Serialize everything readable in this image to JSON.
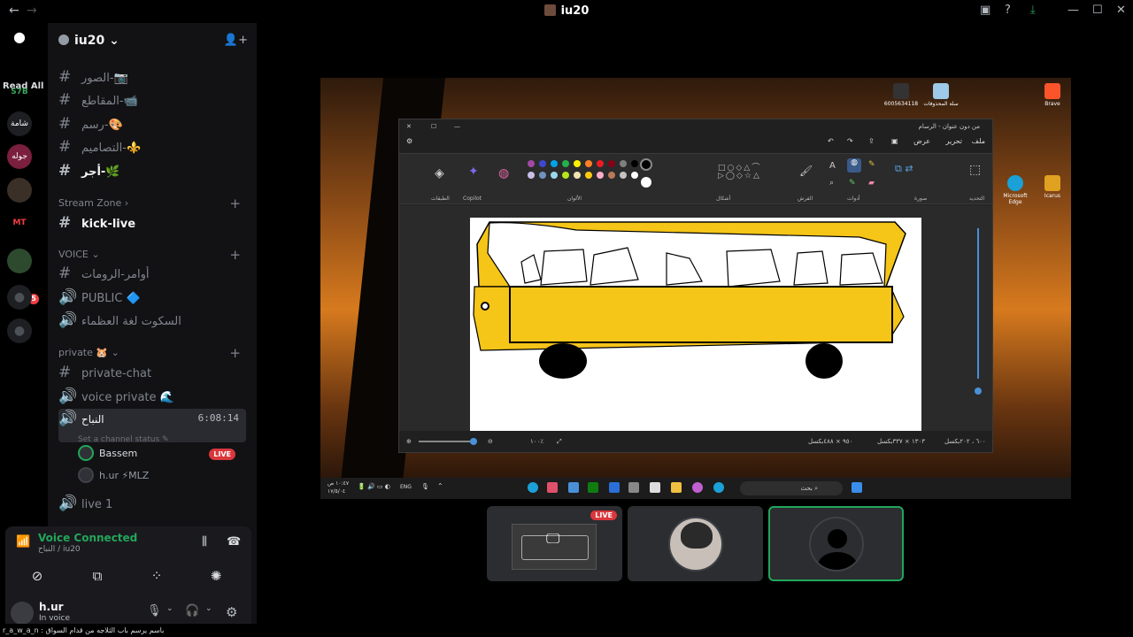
{
  "window": {
    "title": "iu20",
    "back": "←",
    "forward": "→"
  },
  "servers": {
    "read_all": "Read All",
    "s1": "S7B",
    "s2": "شامة",
    "s3": "جوله",
    "s4": "MT",
    "badge": "5"
  },
  "guild": {
    "name": "iu20"
  },
  "channels": {
    "c1": "الصور-📷",
    "c2": "المقاطع-📹",
    "c3": "رسم-🎨",
    "c4": "التصاميم-⚜️",
    "c5": "أجر-🌿",
    "cat_stream": "Stream Zone",
    "c6": "kick-live",
    "cat_voice": "VOICE",
    "c7": "أوامر-الرومات",
    "c8": "PUBLIC 🔷",
    "c9": "السكوت لغة العظماء",
    "cat_private": "private 🐹",
    "c10": "private-chat",
    "c11": "voice private 🌊",
    "c12": "النباح",
    "timer": "6:08:14",
    "status": "Set a channel status ✎",
    "user1": "Bassem",
    "user1_live": "LIVE",
    "user2": "h.ur ⚡MLZ",
    "c13": "live 1"
  },
  "voice_panel": {
    "connected": "Voice Connected",
    "location": "النباح / iu20",
    "user": "h.ur",
    "user_status": "In voice"
  },
  "ticker": "r_a_w_a_n : باسم يرسم باب الثلاجه من قدام السواق",
  "stream": {
    "paint_title": "من دون عنوان - الرسام",
    "menu_file": "ملف",
    "menu_edit": "تحرير",
    "menu_view": "عرض",
    "grp_select": "التحديد",
    "grp_image": "صورة",
    "grp_tools": "أدوات",
    "grp_brushes": "الفرش",
    "grp_shapes": "أشكال",
    "grp_colors": "الألوان",
    "grp_copilot": "Copilot",
    "grp_layers": "الطبقات",
    "status_size": "١٣٠٣ × ٣٣٧بكسل",
    "status_canvas": "٩٥٠ × ٤٨٨بكسل",
    "status_pos": "٦٠٠ ، ٢٠٢بكسل",
    "zoom": "١٠٠٪",
    "desktop_icon1": "6005634118",
    "desktop_icon2": "سلة المحذوفات",
    "desktop_icon3": "Brave",
    "desktop_icon4": "Microsoft Edge",
    "desktop_icon5": "Icarus",
    "taskbar_search": "بحث",
    "taskbar_lang": "ENG",
    "taskbar_time": "١٠:٤٧ ص",
    "taskbar_date": "١٧/٥/٠٤"
  },
  "tiles": {
    "live": "LIVE"
  }
}
